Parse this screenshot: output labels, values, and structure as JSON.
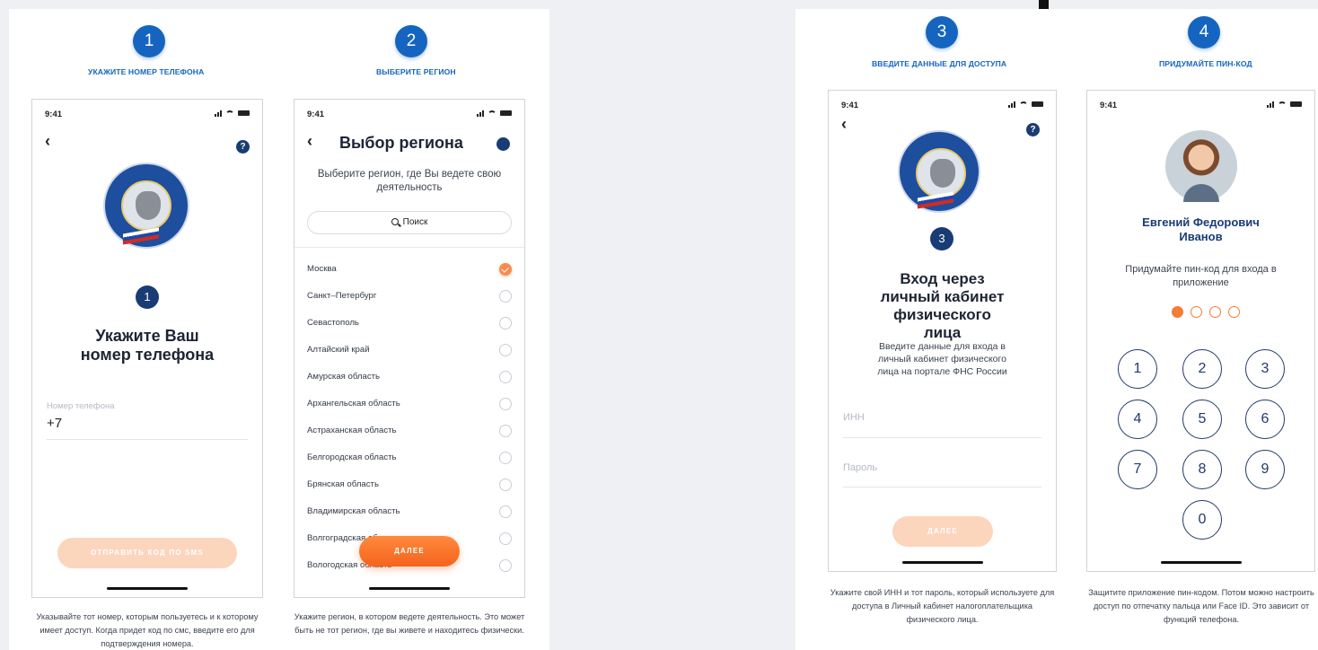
{
  "steps": [
    {
      "number": "1",
      "title": "УКАЖИТЕ НОМЕР ТЕЛЕФОНА",
      "phone": {
        "time": "9:41",
        "badge": "1",
        "heading": "Укажите Ваш номер телефона",
        "field_label": "Номер телефона",
        "field_value": "+7",
        "button": "ОТПРАВИТЬ КОД ПО SMS"
      },
      "caption": "Указывайте тот номер, которым пользуетесь и к которому имеет доступ. Когда придет код по смс, введите его для подтверждения номера."
    },
    {
      "number": "2",
      "title": "ВЫБЕРИТЕ РЕГИОН",
      "phone": {
        "time": "9:41",
        "heading": "Выбор региона",
        "subtitle": "Выберите регион, где Вы ведете свою деятельность",
        "search_placeholder": "Поиск",
        "regions": [
          "Москва",
          "Санкт–Петербург",
          "Севастополь",
          "Алтайский край",
          "Амурская область",
          "Архангельская область",
          "Астраханская область",
          "Белгородская область",
          "Брянская область",
          "Владимирская область",
          "Волгоградская область",
          "Вологодская область"
        ],
        "selected_region": "Москва",
        "button": "ДАЛЕЕ"
      },
      "caption": "Укажите регион, в котором ведете деятельность. Это может быть не тот регион, где вы живете и находитесь физически."
    },
    {
      "number": "3",
      "title": "ВВЕДИТЕ ДАННЫЕ ДЛЯ ДОСТУПА",
      "phone": {
        "time": "9:41",
        "badge": "3",
        "heading": "Вход через личный кабинет физического лица",
        "subtitle": "Введите данные для входа в личный кабинет физического лица на портале ФНС России",
        "inn_placeholder": "ИНН",
        "password_placeholder": "Пароль",
        "button": "ДАЛЕЕ"
      },
      "caption": "Укажите свой ИНН и тот пароль, который используете для доступа в Личный кабинет налогоплательщика физического лица."
    },
    {
      "number": "4",
      "title": "ПРИДУМАЙТЕ ПИН-КОД",
      "phone": {
        "time": "9:41",
        "user_name": "Евгений Федорович Иванов",
        "prompt": "Придумайте пин-код для входа в приложение",
        "pin_filled": 1,
        "pin_length": 4,
        "keys": [
          "1",
          "2",
          "3",
          "4",
          "5",
          "6",
          "7",
          "8",
          "9",
          "0"
        ]
      },
      "caption": "Защитите приложение пин-кодом. Потом можно настроить доступ по отпечатку пальца или Face ID. Это зависит от функций телефона."
    }
  ],
  "colors": {
    "accent_blue": "#1565c0",
    "navy": "#1a3c74",
    "orange": "#f57c33",
    "orange_pale": "#fcd5bd"
  }
}
